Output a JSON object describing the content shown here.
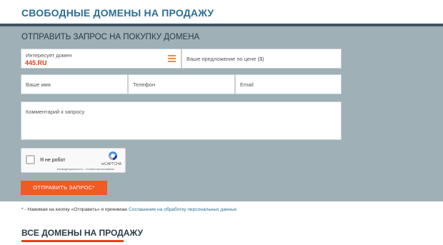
{
  "header": {
    "title": "СВОБОДНЫЕ ДОМЕНЫ НА ПРОДАЖУ"
  },
  "form": {
    "title": "ОТПРАВИТЬ ЗАПРОС НА ПОКУПКУ ДОМЕНА",
    "domain_label": "Интересует домен",
    "domain_value": "445.RU",
    "offer_placeholder": "Ваше предложение по цене ($)",
    "name_placeholder": "Ваше имя",
    "phone_placeholder": "Телефон",
    "email_placeholder": "Email",
    "comment_placeholder": "Комментарий к запросу",
    "captcha": {
      "label": "Я не робот",
      "brand": "reCAPTCHA",
      "privacy": "Конфиденциальность",
      "terms": "Условия использования"
    },
    "submit_label": "ОТПРАВИТЬ ЗАПРОС*"
  },
  "note": {
    "text": "* - Нажимая на кнопку «Отправить» я принимаю",
    "link": "Соглашение на обработку персональных данных."
  },
  "section": {
    "title": "ВСЕ ДОМЕНЫ НА ПРОДАЖУ"
  },
  "colors": {
    "accent": "#f05a24",
    "brand_blue": "#2a6f95",
    "panel": "#9fb0b7"
  }
}
